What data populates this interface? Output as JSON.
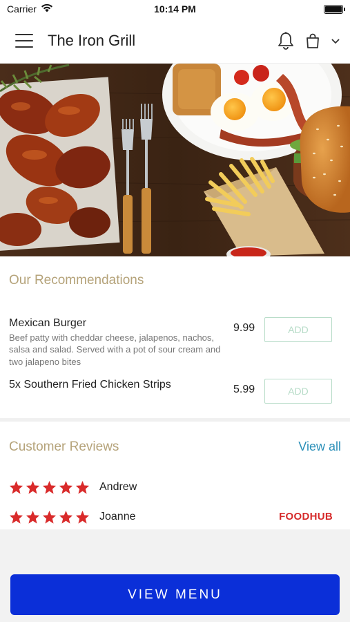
{
  "status_bar": {
    "carrier": "Carrier",
    "time": "10:14 PM"
  },
  "header": {
    "title": "The Iron Grill"
  },
  "recommendations": {
    "title": "Our Recommendations",
    "items": [
      {
        "name": "Mexican Burger",
        "description": "Beef patty with cheddar cheese, jalapenos, nachos, salsa and salad. Served with a pot of sour cream and two jalapeno bites",
        "price": "9.99",
        "add_label": "ADD"
      },
      {
        "name": "5x Southern Fried Chicken Strips",
        "description": "",
        "price": "5.99",
        "add_label": "ADD"
      }
    ]
  },
  "reviews": {
    "title": "Customer Reviews",
    "view_all_label": "View all",
    "entries": [
      {
        "name": "Andrew",
        "rating": 5
      },
      {
        "name": "Joanne",
        "rating": 5
      }
    ],
    "brand_label": "FOODHUB"
  },
  "footer": {
    "view_menu_label": "VIEW MENU"
  },
  "colors": {
    "accent_gold": "#b5a37a",
    "link_blue": "#2a8fb8",
    "button_blue": "#0b2fd8",
    "star_red": "#d92b2b",
    "add_border_green": "#b7dcc8"
  }
}
